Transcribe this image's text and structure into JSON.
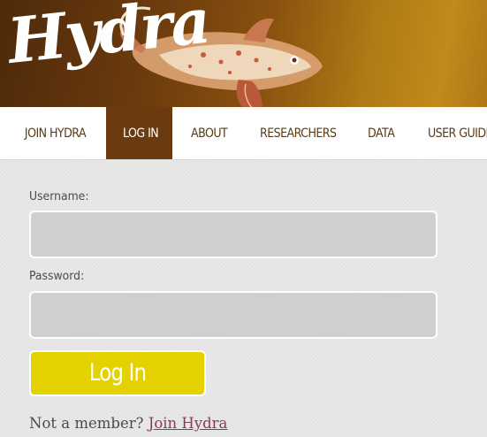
{
  "brand": {
    "logo_text": "Hydra"
  },
  "nav": {
    "items": [
      {
        "label": "JOIN HYDRA",
        "active": false
      },
      {
        "label": "LOG IN",
        "active": true
      },
      {
        "label": "ABOUT",
        "active": false
      },
      {
        "label": "RESEARCHERS",
        "active": false
      },
      {
        "label": "DATA",
        "active": false
      },
      {
        "label": "USER GUIDE",
        "active": false
      }
    ]
  },
  "login_form": {
    "username_label": "Username:",
    "username_value": "",
    "password_label": "Password:",
    "password_value": "",
    "submit_label": "Log In",
    "member_prompt": "Not a member?",
    "join_link": "Join Hydra"
  },
  "colors": {
    "header_dark": "#4e2a0a",
    "header_gold": "#c08a1c",
    "nav_active_bg": "#6b3a0e",
    "button_yellow": "#e3d100",
    "link_color": "#8a3a5a"
  }
}
